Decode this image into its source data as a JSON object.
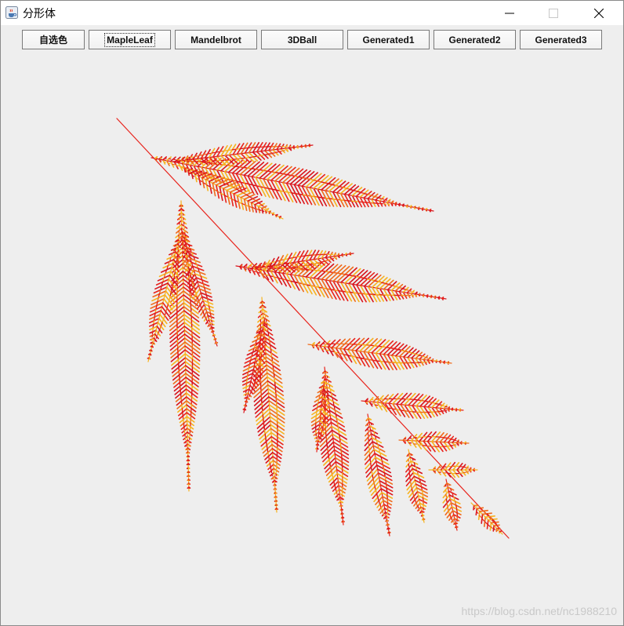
{
  "window": {
    "title": "分形体",
    "icon": "java-cup-icon",
    "controls": [
      "minimize-icon",
      "maximize-icon",
      "close-icon"
    ]
  },
  "toolbar": {
    "buttons": [
      {
        "label": "自选色"
      },
      {
        "label": "MapleLeaf"
      },
      {
        "label": "Mandelbrot"
      },
      {
        "label": "3DBall"
      },
      {
        "label": "Generated1"
      },
      {
        "label": "Generated2"
      },
      {
        "label": "Generated3"
      }
    ]
  },
  "canvas": {
    "fractal": "fern-like leaf fractal",
    "colors": [
      "#e8231c",
      "#f06a1a",
      "#f7b21e",
      "#d9141c"
    ]
  },
  "watermark": "https://blog.csdn.net/nc1988210"
}
